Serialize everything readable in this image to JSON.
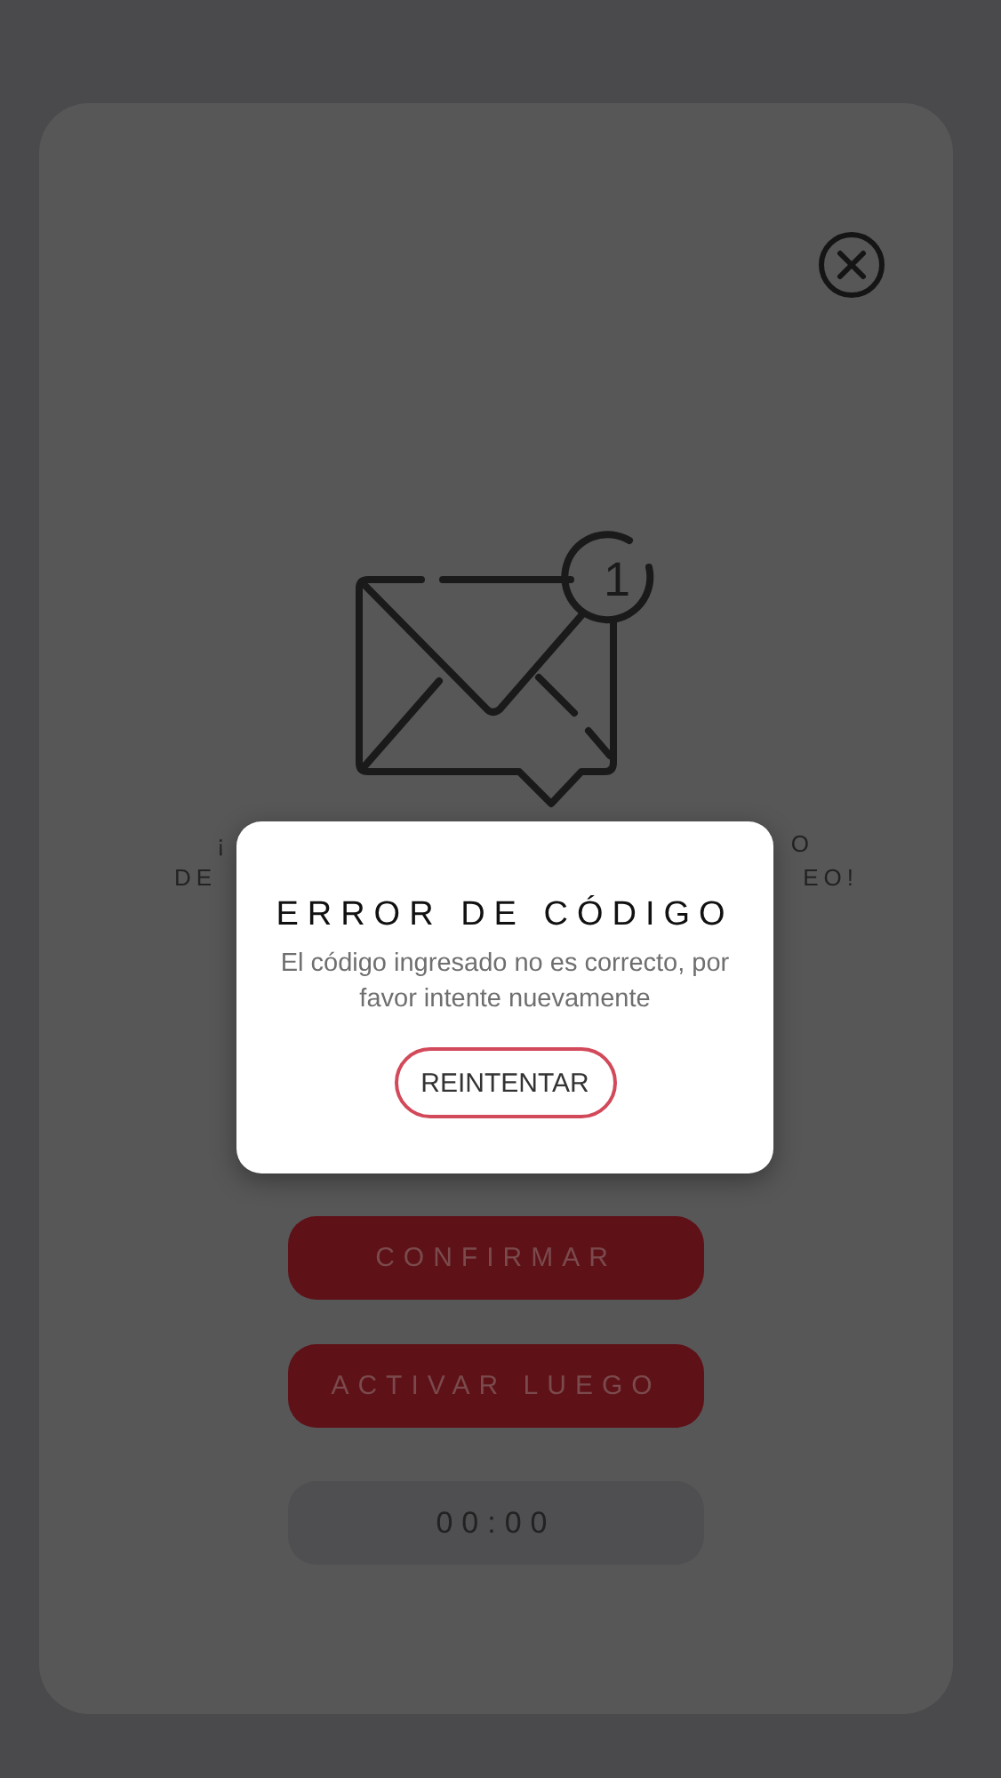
{
  "background_message": {
    "line_1_start": "¡",
    "line_1_end": "O",
    "line_2_start": "DE",
    "line_2_end": "EO!"
  },
  "notification_count": "1",
  "buttons": [
    {
      "label": "CONFIRMAR",
      "kind": "primary"
    },
    {
      "label": "ACTIVAR LUEGO",
      "kind": "primary"
    },
    {
      "label": "00:00",
      "kind": "timer"
    }
  ],
  "dialog": {
    "title": "ERROR DE CÓDIGO",
    "message": "El código ingresado no es correcto, por favor intente nuevamente",
    "button": "REINTENTAR"
  }
}
